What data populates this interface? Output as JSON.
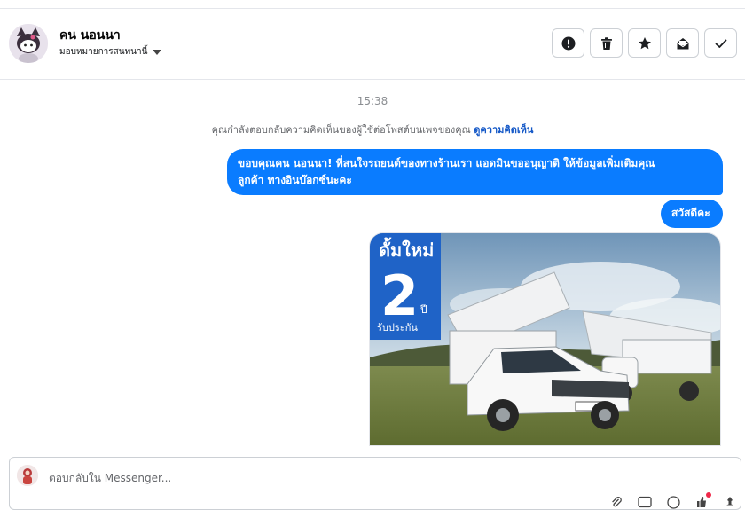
{
  "header": {
    "name": "คน นอนนา",
    "assign_label": "มอบหมายการสนทนานี้"
  },
  "actions": [
    {
      "icon": "exclamation-icon",
      "label": "Mark as spam"
    },
    {
      "icon": "trash-icon",
      "label": "Delete"
    },
    {
      "icon": "star-icon",
      "label": "Star"
    },
    {
      "icon": "mark-unread-icon",
      "label": "Mark unread"
    },
    {
      "icon": "check-icon",
      "label": "Done"
    }
  ],
  "conversation": {
    "timestamp": "15:38",
    "notice_text": "คุณกำลังตอบกลับความคิดเห็นของผู้ใช้ต่อโพสต์บนเพจของคุณ",
    "notice_link": "ดูความคิดเห็น",
    "messages": [
      {
        "line1": "ขอบคุณคน นอนนา! ที่สนใจรถยนต์ของทางร้านเรา แอดมินขออนุญาติ ให้ข้อมูลเพิ่มเติมคุณ",
        "line2": "ลูกค้า ทางอินบ๊อกซ์นะคะ"
      },
      {
        "text": "สวัสดีคะ"
      }
    ],
    "image_card": {
      "headline": "ดั้มใหม่",
      "big_number": "2",
      "unit": "ปี",
      "caption": "รับประกัน"
    }
  },
  "composer": {
    "placeholder": "ตอบกลับใน Messenger..."
  },
  "colors": {
    "accent": "#0a7cff",
    "link": "#1458c7",
    "badge": "#f02849"
  }
}
